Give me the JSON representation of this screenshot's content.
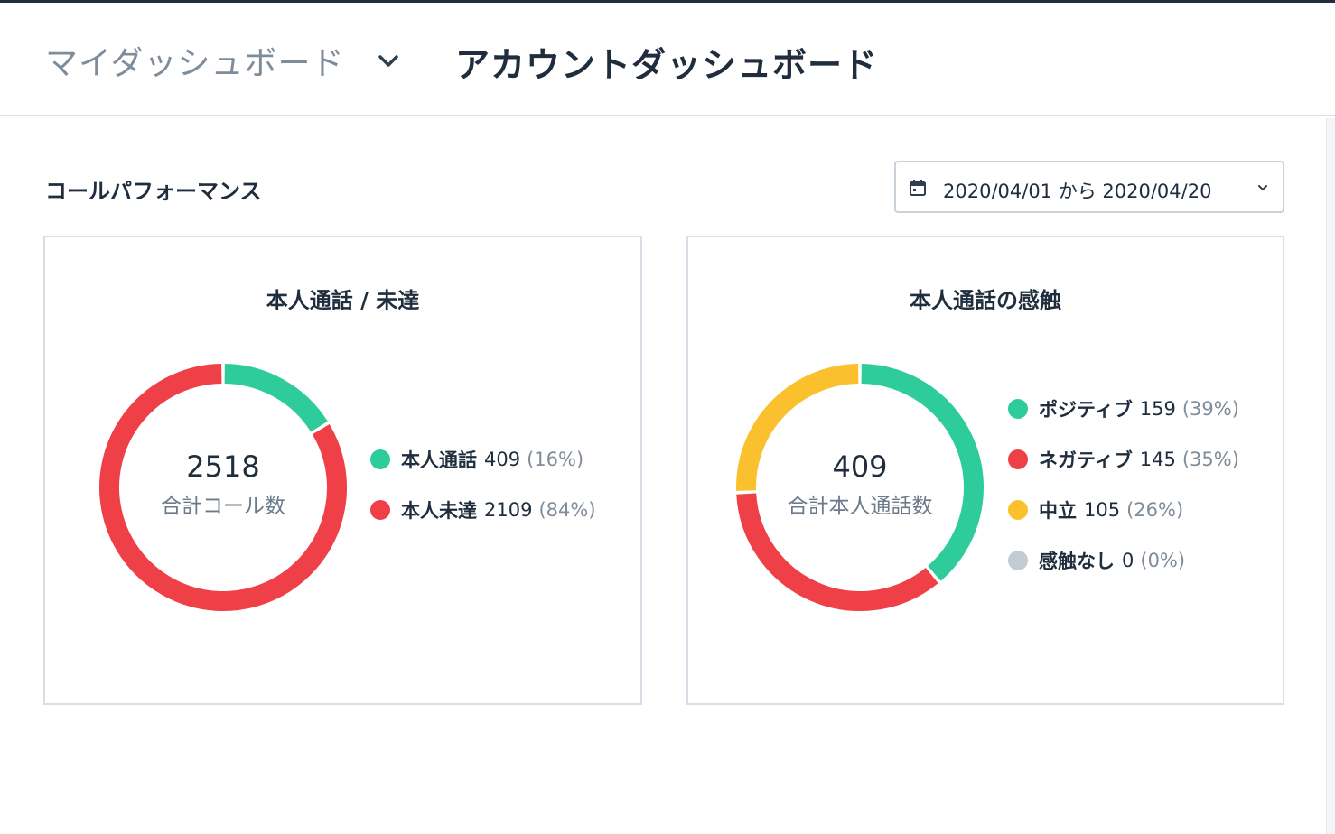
{
  "header": {
    "dashboard_selector": "マイダッシュボード",
    "title": "アカウントダッシュボード"
  },
  "section": {
    "title": "コールパフォーマンス"
  },
  "date_range": {
    "label": "2020/04/01 から 2020/04/20"
  },
  "charts": [
    {
      "title": "本人通話 / 未達",
      "center_value": "2518",
      "center_label": "合計コール数",
      "legend": [
        {
          "name": "本人通話",
          "count": "409",
          "pct": "(16%)"
        },
        {
          "name": "本人未達",
          "count": "2109",
          "pct": "(84%)"
        }
      ]
    },
    {
      "title": "本人通話の感触",
      "center_value": "409",
      "center_label": "合計本人通話数",
      "legend": [
        {
          "name": "ポジティブ",
          "count": "159",
          "pct": "(39%)"
        },
        {
          "name": "ネガティブ",
          "count": "145",
          "pct": "(35%)"
        },
        {
          "name": "中立",
          "count": "105",
          "pct": "(26%)"
        },
        {
          "name": "感触なし",
          "count": "0",
          "pct": "(0%)"
        }
      ]
    }
  ],
  "chart_data": [
    {
      "type": "pie",
      "title": "本人通話 / 未達",
      "categories": [
        "本人通話",
        "本人未達"
      ],
      "values": [
        409,
        2109
      ],
      "colors": [
        "#2ecc9a",
        "#ef4048"
      ],
      "total": 2518
    },
    {
      "type": "pie",
      "title": "本人通話の感触",
      "categories": [
        "ポジティブ",
        "ネガティブ",
        "中立",
        "感触なし"
      ],
      "values": [
        159,
        145,
        105,
        0
      ],
      "colors": [
        "#2ecc9a",
        "#ef4048",
        "#fbc02d",
        "#c2cad3"
      ],
      "total": 409
    }
  ]
}
